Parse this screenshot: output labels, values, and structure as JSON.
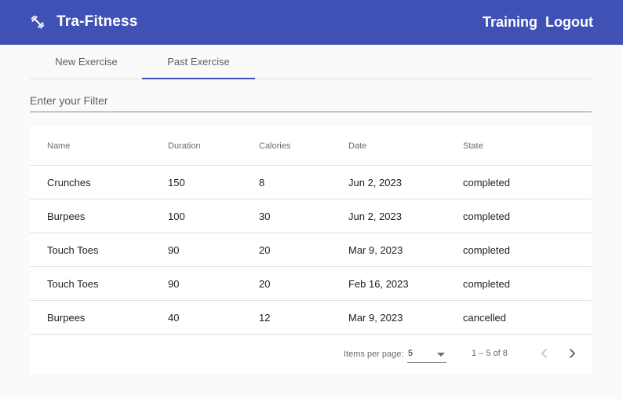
{
  "app": {
    "title": "Tra-Fitness",
    "icon": "dumbbell-icon"
  },
  "nav": {
    "training": "Training",
    "logout": "Logout"
  },
  "tabs": [
    {
      "label": "New Exercise",
      "active": false
    },
    {
      "label": "Past Exercise",
      "active": true
    }
  ],
  "filter": {
    "placeholder": "Enter your Filter",
    "value": ""
  },
  "table": {
    "headers": [
      "Name",
      "Duration",
      "Calories",
      "Date",
      "State"
    ],
    "rows": [
      [
        "Crunches",
        "150",
        "8",
        "Jun 2, 2023",
        "completed"
      ],
      [
        "Burpees",
        "100",
        "30",
        "Jun 2, 2023",
        "completed"
      ],
      [
        "Touch Toes",
        "90",
        "20",
        "Mar 9, 2023",
        "completed"
      ],
      [
        "Touch Toes",
        "90",
        "20",
        "Feb 16, 2023",
        "completed"
      ],
      [
        "Burpees",
        "40",
        "12",
        "Mar 9, 2023",
        "cancelled"
      ]
    ]
  },
  "paginator": {
    "items_per_page_label": "Items per page:",
    "items_per_page_value": "5",
    "range_label": "1 – 5 of 8",
    "prev_icon": "chevron-left-icon",
    "next_icon": "chevron-right-icon"
  },
  "colors": {
    "primary": "#3f51b5",
    "background": "#fafafa",
    "card": "#ffffff",
    "divider": "#e0e0e0"
  }
}
